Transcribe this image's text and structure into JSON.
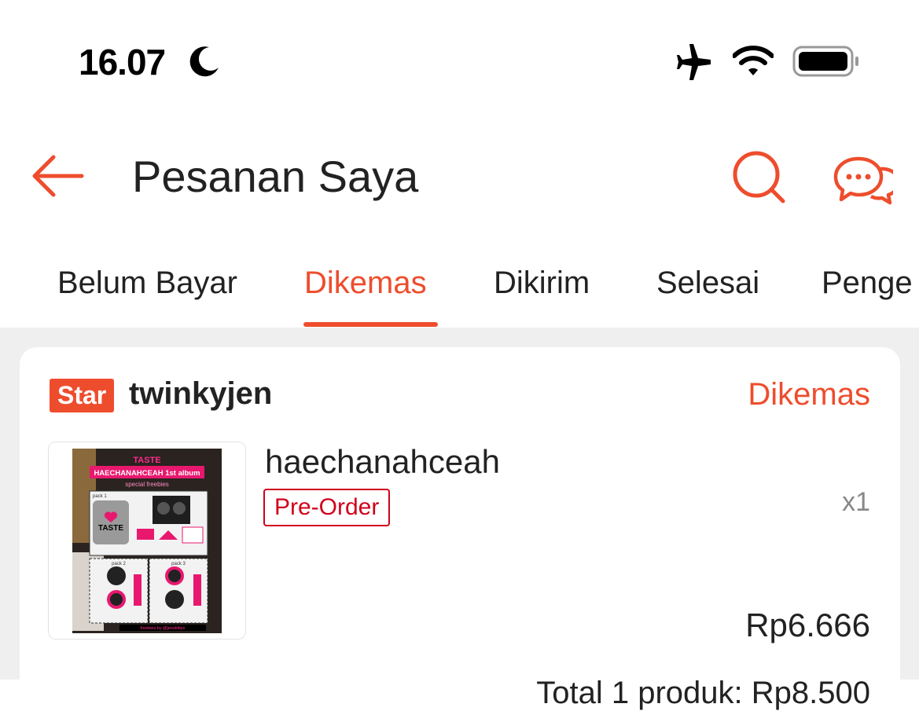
{
  "status_bar": {
    "time": "16.07",
    "icons": [
      "moon-icon",
      "airplane-icon",
      "wifi-icon",
      "battery-icon"
    ]
  },
  "header": {
    "title": "Pesanan Saya",
    "accent_color": "#ee4d2d"
  },
  "tabs": [
    {
      "label": "Belum Bayar",
      "active": false
    },
    {
      "label": "Dikemas",
      "active": true
    },
    {
      "label": "Dikirim",
      "active": false
    },
    {
      "label": "Selesai",
      "active": false
    },
    {
      "label": "Penge",
      "active": false
    }
  ],
  "order": {
    "badge": "Star",
    "shop_name": "twinkyjen",
    "status": "Dikemas",
    "product": {
      "name": "haechanahceah",
      "tag": "Pre-Order",
      "quantity": "x1",
      "price": "Rp6.666",
      "image_text": {
        "brand": "TASTE",
        "title": "HAECHANAHCEAH 1st album",
        "subtitle": "special freebies",
        "pack1": "pack 1",
        "pack2": "pack 2",
        "pack3": "pack 3",
        "logo": "TASTE",
        "footer": "freebies by @jenskittys"
      }
    },
    "total_partial": "Total 1 produk: Rp8.500"
  }
}
